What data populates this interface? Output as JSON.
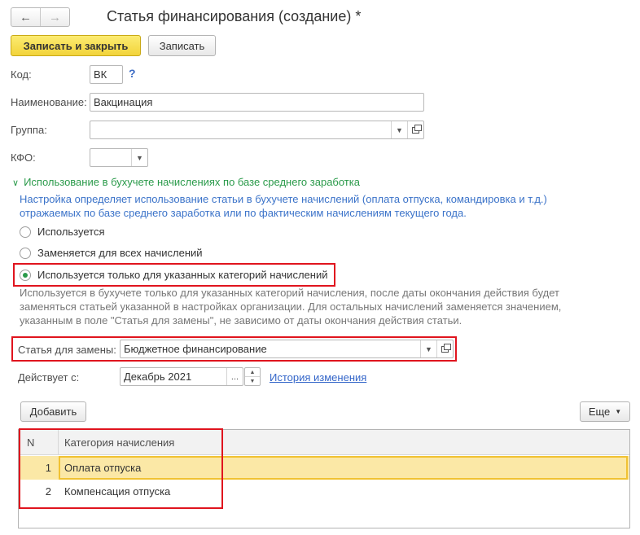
{
  "window": {
    "title": "Статья финансирования (создание) *",
    "back_icon": "arrow-left-icon",
    "forward_icon": "arrow-right-icon"
  },
  "toolbar": {
    "save_close_label": "Записать и закрыть",
    "save_label": "Записать"
  },
  "form": {
    "code_label": "Код:",
    "code_value": "ВК",
    "code_help": "?",
    "name_label": "Наименование:",
    "name_value": "Вакцинация",
    "group_label": "Группа:",
    "group_value": "",
    "kfo_label": "КФО:",
    "kfo_value": ""
  },
  "usage_section": {
    "header": "Использование в бухучете начислениях по базе среднего заработка",
    "description": "Настройка определяет использование статьи в бухучете начислений (оплата отпуска, командировка и т.д.) отражаемых по базе среднего заработка или по фактическим начислениям текущего года.",
    "options": [
      {
        "label": "Используется",
        "checked": false
      },
      {
        "label": "Заменяется для всех начислений",
        "checked": false
      },
      {
        "label": "Используется только для указанных категорий начислений",
        "checked": true
      }
    ],
    "option_hint": "Используется в бухучете только для указанных категорий начисления, после даты окончания действия будет заменяться статьей указанной в настройках организации. Для остальных начислений заменяется значением, указанным в поле \"Статья для замены\", не зависимо от даты окончания действия статьи."
  },
  "replacement": {
    "label": "Статья для замены:",
    "value": "Бюджетное финансирование",
    "effective_label": "Действует с:",
    "effective_value": "Декабрь 2021",
    "ellipsis": "...",
    "history_link": "История изменения"
  },
  "table_toolbar": {
    "add_label": "Добавить",
    "more_label": "Еще"
  },
  "table": {
    "columns": [
      "N",
      "Категория начисления"
    ],
    "rows": [
      {
        "n": "1",
        "category": "Оплата отпуска",
        "selected": true
      },
      {
        "n": "2",
        "category": "Компенсация отпуска",
        "selected": false
      }
    ]
  },
  "colors": {
    "accent_green": "#2a9a4a",
    "hint_blue": "#3b73c9",
    "highlight_red": "#e0141e",
    "primary_button": "#f2d33a",
    "selected_row": "#fbe8a6"
  }
}
